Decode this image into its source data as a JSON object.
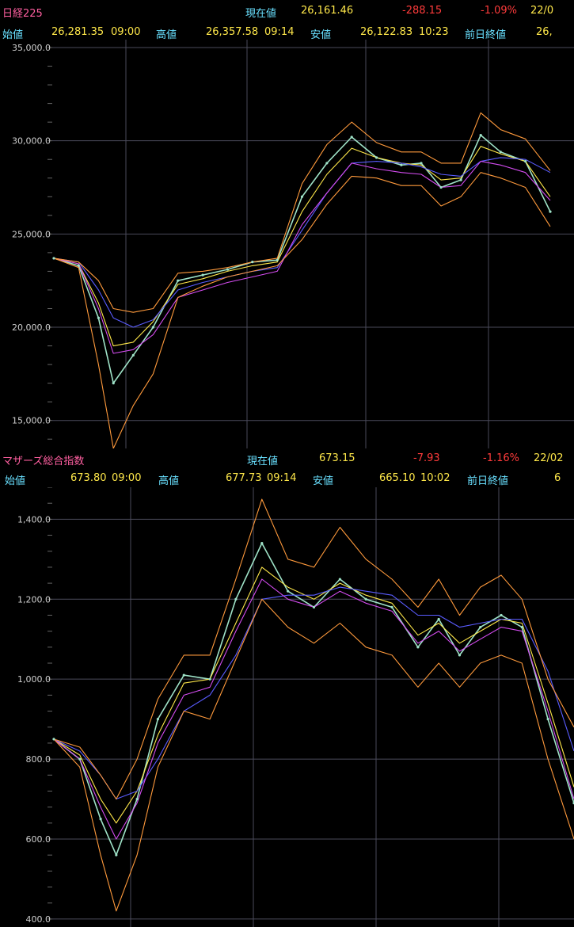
{
  "panels": [
    {
      "id": "nikkei",
      "title": "日経225",
      "current_label": "現在値",
      "current_value": "26,161.46",
      "change": "-288.15",
      "change_pct": "-1.09%",
      "date": "22/0",
      "open_label": "始値",
      "open_value": "26,281.35",
      "open_time": "09:00",
      "high_label": "高値",
      "high_value": "26,357.58",
      "high_time": "09:14",
      "low_label": "安値",
      "low_value": "26,122.83",
      "low_time": "10:23",
      "prev_label": "前日終値",
      "prev_value": "26,"
    },
    {
      "id": "mothers",
      "title": "マザーズ総合指数",
      "current_label": "現在値",
      "current_value": "673.15",
      "change": "-7.93",
      "change_pct": "-1.16%",
      "date": "22/02",
      "open_label": "始値",
      "open_value": "673.80",
      "open_time": "09:00",
      "high_label": "高値",
      "high_value": "677.73",
      "high_time": "09:14",
      "low_label": "安値",
      "low_value": "665.10",
      "low_time": "10:02",
      "prev_label": "前日終値",
      "prev_value": "6"
    }
  ],
  "chart_data": [
    {
      "type": "line",
      "ylim": [
        13500,
        35000
      ],
      "yticks": [
        15000,
        20000,
        25000,
        30000,
        35000
      ],
      "ytick_labels": [
        "15,000.0",
        "20,000.0",
        "25,000.0",
        "30,000.0",
        "35,000.0"
      ],
      "grid": true,
      "x": [
        0,
        5,
        9,
        12,
        16,
        20,
        25,
        30,
        35,
        40,
        45,
        50,
        55,
        60,
        65,
        70,
        74,
        78,
        82,
        86,
        90,
        95,
        100
      ],
      "series": [
        {
          "color": "#9fe3c8",
          "values": [
            23700,
            23300,
            20500,
            17000,
            18500,
            20000,
            22500,
            22800,
            23100,
            23500,
            23600,
            27000,
            28800,
            30200,
            29100,
            28700,
            28800,
            27500,
            27900,
            30300,
            29400,
            28900,
            26200
          ]
        },
        {
          "color": "#ffe84a",
          "values": [
            23700,
            23400,
            21300,
            19000,
            19200,
            20300,
            22300,
            22600,
            23000,
            23300,
            23500,
            26200,
            28200,
            29600,
            29100,
            28800,
            28700,
            27900,
            28000,
            29700,
            29300,
            28900,
            27000
          ]
        },
        {
          "color": "#5a5cff",
          "values": [
            23700,
            23500,
            22000,
            20500,
            20000,
            20400,
            22000,
            22400,
            22700,
            23000,
            23200,
            25200,
            27200,
            28800,
            28900,
            28800,
            28600,
            28200,
            28100,
            28900,
            29100,
            29000,
            28300
          ]
        },
        {
          "color": "#d44cf0",
          "values": [
            23700,
            23400,
            21000,
            18600,
            18800,
            19600,
            21600,
            22000,
            22400,
            22700,
            23000,
            25500,
            27200,
            28800,
            28500,
            28300,
            28200,
            27500,
            27600,
            28900,
            28700,
            28300,
            26800
          ]
        },
        {
          "color": "#ff9a3c",
          "values": [
            23700,
            23500,
            22500,
            21000,
            20800,
            21000,
            22900,
            23000,
            23200,
            23500,
            23700,
            27700,
            29800,
            31000,
            29900,
            29400,
            29400,
            28800,
            28800,
            31500,
            30600,
            30100,
            28400
          ]
        },
        {
          "color": "#ff9a3c",
          "values": [
            23700,
            23200,
            18000,
            13500,
            15800,
            17500,
            21600,
            22200,
            22700,
            23000,
            23300,
            24700,
            26600,
            28100,
            28000,
            27600,
            27600,
            26500,
            27000,
            28300,
            28000,
            27500,
            25400
          ]
        }
      ]
    },
    {
      "type": "line",
      "ylim": [
        380,
        1480
      ],
      "yticks": [
        400,
        600,
        800,
        1000,
        1200,
        1400
      ],
      "ytick_labels": [
        "400.0",
        "600.0",
        "800.0",
        "1,000.0",
        "1,200.0",
        "1,400.0"
      ],
      "grid": true,
      "x": [
        0,
        5,
        9,
        12,
        16,
        20,
        25,
        30,
        35,
        40,
        45,
        50,
        55,
        60,
        65,
        70,
        74,
        78,
        82,
        86,
        90,
        95,
        100
      ],
      "series": [
        {
          "color": "#9fe3c8",
          "values": [
            850,
            800,
            650,
            560,
            700,
            900,
            1010,
            1000,
            1200,
            1340,
            1220,
            1180,
            1250,
            1200,
            1180,
            1080,
            1150,
            1060,
            1130,
            1160,
            1130,
            900,
            690
          ]
        },
        {
          "color": "#ffe84a",
          "values": [
            850,
            810,
            700,
            640,
            720,
            860,
            990,
            1000,
            1140,
            1280,
            1230,
            1200,
            1240,
            1210,
            1190,
            1110,
            1140,
            1090,
            1120,
            1150,
            1140,
            940,
            730
          ]
        },
        {
          "color": "#5a5cff",
          "values": [
            850,
            820,
            760,
            700,
            720,
            800,
            920,
            960,
            1060,
            1200,
            1210,
            1210,
            1230,
            1220,
            1210,
            1160,
            1160,
            1130,
            1140,
            1150,
            1150,
            1020,
            820
          ]
        },
        {
          "color": "#d44cf0",
          "values": [
            850,
            800,
            680,
            600,
            690,
            840,
            960,
            980,
            1120,
            1250,
            1200,
            1180,
            1220,
            1190,
            1170,
            1090,
            1120,
            1070,
            1100,
            1130,
            1120,
            920,
            700
          ]
        },
        {
          "color": "#ff9a3c",
          "values": [
            850,
            830,
            760,
            700,
            800,
            950,
            1060,
            1060,
            1250,
            1450,
            1300,
            1280,
            1380,
            1300,
            1250,
            1180,
            1250,
            1160,
            1230,
            1260,
            1200,
            1000,
            880
          ]
        },
        {
          "color": "#ff9a3c",
          "values": [
            850,
            780,
            560,
            420,
            560,
            780,
            920,
            900,
            1050,
            1200,
            1130,
            1090,
            1140,
            1080,
            1060,
            980,
            1040,
            980,
            1040,
            1060,
            1040,
            800,
            600
          ]
        }
      ]
    }
  ]
}
